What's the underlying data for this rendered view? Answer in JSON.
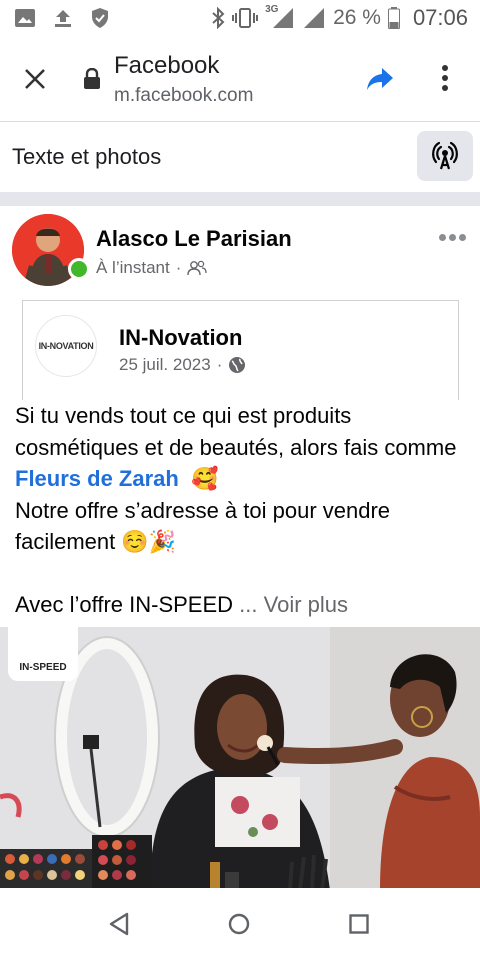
{
  "status_bar": {
    "network": "3G",
    "battery_percent": "26 %",
    "time": "07:06",
    "icons": [
      "image-icon",
      "upload-icon",
      "shield-icon",
      "bluetooth-icon",
      "vibrate-icon",
      "signal-icon",
      "battery-icon"
    ]
  },
  "browser": {
    "title": "Facebook",
    "url": "m.facebook.com",
    "accent_color": "#1a73e8"
  },
  "composer": {
    "label": "Texte et photos"
  },
  "post": {
    "author": "Alasco Le Parisian",
    "time": "À l’instant",
    "separator": "·",
    "shared": {
      "page_name": "IN-Novation",
      "logo_text": "IN-NOVATION",
      "date": "25 juil. 2023",
      "separator": "·"
    },
    "text": {
      "line1": "Si tu vends tout ce qui est produits cosmétiques et de beautés, alors fais comme",
      "link": "Fleurs de Zarah",
      "emoji1": "🥰",
      "line2": "Notre offre s’adresse à toi pour vendre facilement ☺️🎉",
      "line3": "Avec l’offre IN-SPEED",
      "see_more": "... Voir plus"
    },
    "image_badge": "IN-SPEED",
    "link_color": "#216fdb"
  }
}
